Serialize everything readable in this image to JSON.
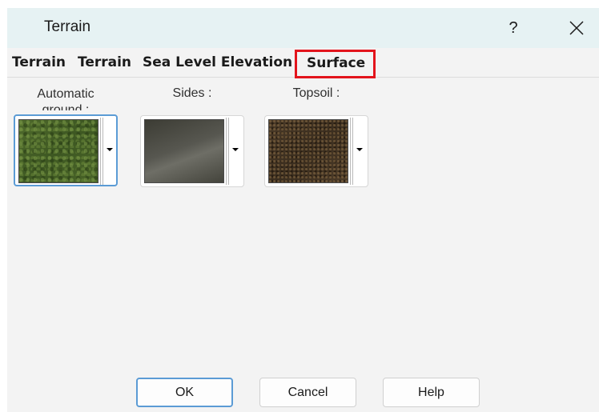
{
  "window": {
    "title": "Terrain",
    "help_glyph": "?",
    "close_icon": "close-icon"
  },
  "tabs": [
    {
      "label": "Terrain"
    },
    {
      "label": "Terrain"
    },
    {
      "label": "Sea Level Elevation"
    },
    {
      "label": "Surface",
      "active": true,
      "highlight_color": "#e3141c"
    }
  ],
  "textures": [
    {
      "label": "Automatic ground :",
      "texture": "grass",
      "focused": true
    },
    {
      "label": "Sides :",
      "texture": "rock"
    },
    {
      "label": "Topsoil :",
      "texture": "soil"
    }
  ],
  "buttons": {
    "ok": "OK",
    "cancel": "Cancel",
    "help": "Help"
  },
  "colors": {
    "focus_accent": "#5b9bd5",
    "tab_highlight": "#e3141c",
    "title_bar": "#e6f2f3"
  }
}
